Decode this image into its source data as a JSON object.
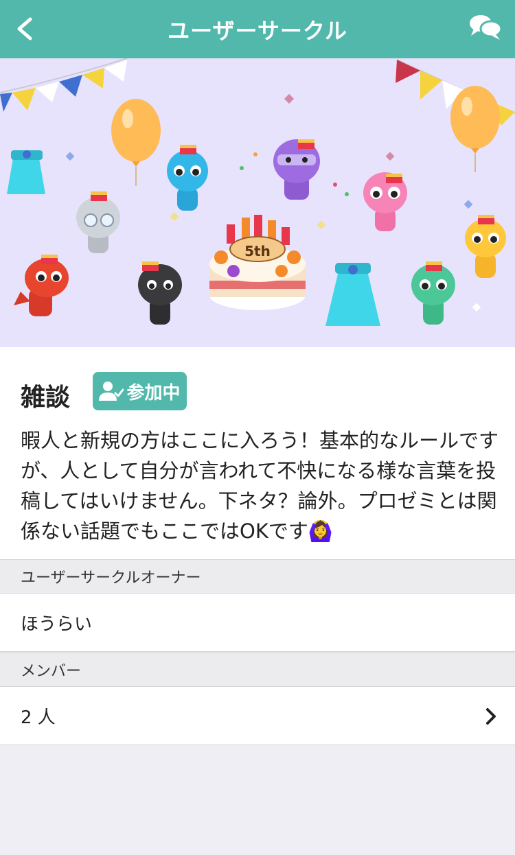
{
  "nav": {
    "title": "ユーザーサークル"
  },
  "banner": {
    "cake_label": "5th"
  },
  "circle": {
    "name": "雑談",
    "badge_label": "参加中",
    "description": "暇人と新規の方はここに入ろう！基本的なルールですが、人として自分が言われて不快になる様な言葉を投稿してはいけません。下ネタ？論外。プロゼミとは関係ない話題でもここではOKです🙆‍♀️"
  },
  "owner": {
    "header": "ユーザーサークルオーナー",
    "name": "ほうらい"
  },
  "members": {
    "header": "メンバー",
    "count": "2 人"
  },
  "colors": {
    "accent": "#51b8ab",
    "banner_bg": "#e8e3fd"
  }
}
